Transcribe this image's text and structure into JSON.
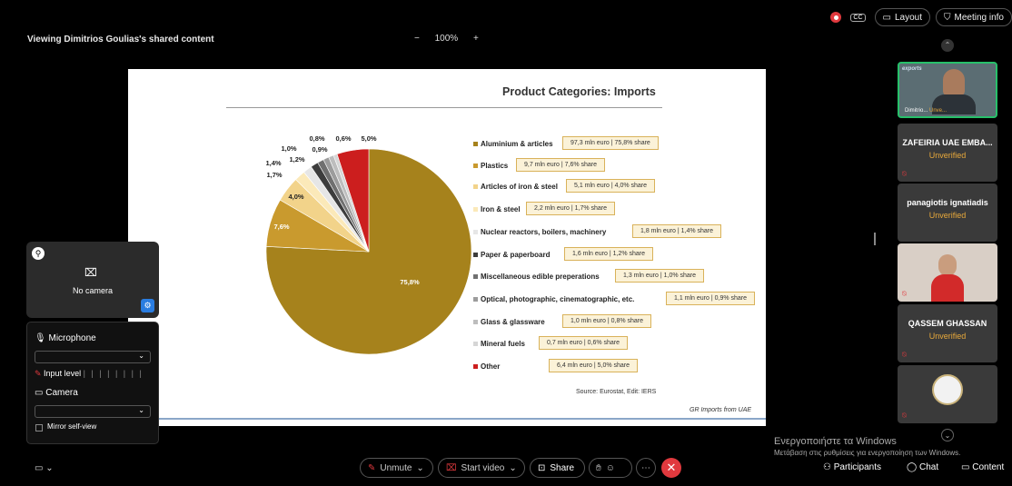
{
  "top": {
    "viewing": "Viewing Dimitrios Goulias's shared content",
    "zoom_minus": "−",
    "zoom": "100%",
    "zoom_plus": "+",
    "layout": "Layout",
    "meeting_info": "Meeting info",
    "cc": "CC"
  },
  "slide": {
    "title": "Product Categories: Imports",
    "source": "Source: Eurostat, Edit: IERS",
    "footer": "GR Imports from UAE"
  },
  "chart_data": {
    "type": "pie",
    "categories": [
      "Aluminium & articles",
      "Plastics",
      "Articles of iron & steel",
      "Iron & steel",
      "Nuclear reactors, boilers, machinery",
      "Paper & paperboard",
      "Miscellaneous edible preperations",
      "Optical, photographic, cinematographic, etc.",
      "Glass & glassware",
      "Mineral fuels",
      "Other"
    ],
    "values": [
      75.8,
      7.6,
      4.0,
      1.7,
      1.4,
      1.2,
      1.0,
      0.9,
      0.8,
      0.6,
      5.0
    ],
    "slice_labels": [
      "75,8%",
      "7,6%",
      "4,0%",
      "1,7%",
      "1,4%",
      "1,2%",
      "1,0%",
      "0,9%",
      "0,8%",
      "0,6%",
      "5,0%"
    ],
    "boxes": [
      "97,3 mln euro | 75,8% share",
      "9,7 mln euro | 7,6% share",
      "5,1 mln euro | 4,0% share",
      "2,2 mln euro | 1,7% share",
      "1,8 mln euro | 1,4% share",
      "1,6 mln euro | 1,2% share",
      "1,3 mln euro | 1,0% share",
      "1,1 mln euro | 0,9% share",
      "1,0 mln euro | 0,8% share",
      "0,7 mln euro | 0,6% share",
      "6,4 mln euro | 5,0% share"
    ],
    "colors": [
      "#a6821c",
      "#c99a2e",
      "#f2d38a",
      "#fbe9b9",
      "#e6e6e6",
      "#3d3d3d",
      "#707070",
      "#9c9c9c",
      "#bdbdbd",
      "#d6d6d6",
      "#cc1e1e"
    ]
  },
  "self": {
    "no_camera": "No camera"
  },
  "devices": {
    "microphone": "Microphone",
    "input_level": "Input level",
    "ticks": "| | | | | | | |",
    "camera": "Camera",
    "mirror": "Mirror self-view"
  },
  "participants": [
    {
      "name": "Dimitrio...",
      "status": "Unve..."
    },
    {
      "name": "ZAFEIRIA UAE EMBA...",
      "status": "Unverified"
    },
    {
      "name": "panagiotis ignatiadis",
      "status": "Unverified"
    },
    {
      "name": "",
      "status": ""
    },
    {
      "name": "QASSEM GHASSAN",
      "status": "Unverified"
    },
    {
      "name": "",
      "status": ""
    }
  ],
  "watermark": {
    "line1": "Ενεργοποιήστε τα Windows",
    "line2": "Μετάβαση στις ρυθμίσεις για ενεργοποίηση των Windows."
  },
  "bottom": {
    "unmute": "Unmute",
    "start_video": "Start video",
    "share": "Share",
    "participants": "Participants",
    "chat": "Chat",
    "content": "Content"
  }
}
